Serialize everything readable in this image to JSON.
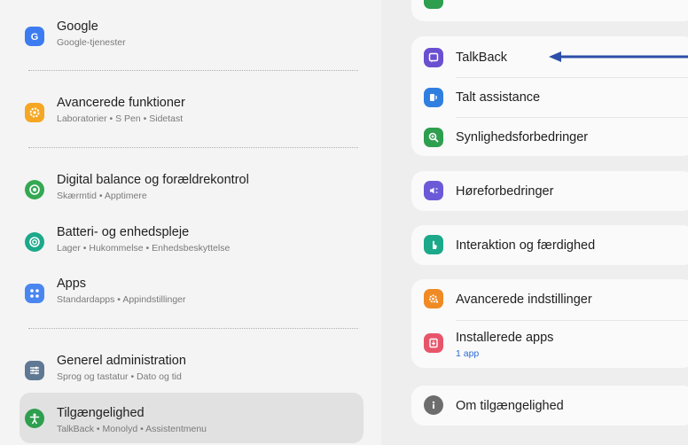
{
  "left_menu": [
    {
      "title": "Google",
      "subtitle": "Google-tjenester",
      "icon": "google-icon",
      "color": "#3d7cf0"
    },
    {
      "title": "Avancerede funktioner",
      "subtitle": "Laboratorier  •  S Pen  •  Sidetast",
      "icon": "gear-plus-icon",
      "color": "#f5a623"
    },
    {
      "title": "Digital balance og forældrekontrol",
      "subtitle": "Skærmtid  •  Apptimere",
      "icon": "wellbeing-icon",
      "color": "#34a853"
    },
    {
      "title": "Batteri- og enhedspleje",
      "subtitle": "Lager  •  Hukommelse  •  Enhedsbeskyttelse",
      "icon": "device-care-icon",
      "color": "#1ba98a"
    },
    {
      "title": "Apps",
      "subtitle": "Standardapps  •  Appindstillinger",
      "icon": "apps-grid-icon",
      "color": "#4a86f0"
    },
    {
      "title": "Generel administration",
      "subtitle": "Sprog og tastatur  •  Dato og tid",
      "icon": "sliders-icon",
      "color": "#5f7893"
    },
    {
      "title": "Tilgængelighed",
      "subtitle": "TalkBack  •  Monolyd  •  Assistentmenu",
      "icon": "accessibility-icon",
      "color": "#2e9e4f"
    }
  ],
  "right_menu": {
    "talkback": {
      "label": "TalkBack",
      "icon": "talkback-icon",
      "color": "#6a4fd0"
    },
    "spoken": {
      "label": "Talt assistance",
      "icon": "spoken-assist-icon",
      "color": "#2f7fe0"
    },
    "visibility": {
      "label": "Synlighedsforbedringer",
      "icon": "magnifier-icon",
      "color": "#2e9e4f"
    },
    "hearing": {
      "label": "Høreforbedringer",
      "icon": "hearing-icon",
      "color": "#6a5ad8"
    },
    "interaction": {
      "label": "Interaktion og færdighed",
      "icon": "touch-hand-icon",
      "color": "#1ba98a"
    },
    "advanced": {
      "label": "Avancerede indstillinger",
      "icon": "advanced-gear-icon",
      "color": "#f08a24"
    },
    "installed": {
      "label": "Installerede apps",
      "sub": "1 app",
      "icon": "installed-apps-icon",
      "color": "#e8556a"
    },
    "about": {
      "label": "Om tilgængelighed",
      "icon": "info-icon",
      "color": "#6d6d6d"
    }
  },
  "annotation": {
    "arrow_color": "#2d4fa8"
  }
}
